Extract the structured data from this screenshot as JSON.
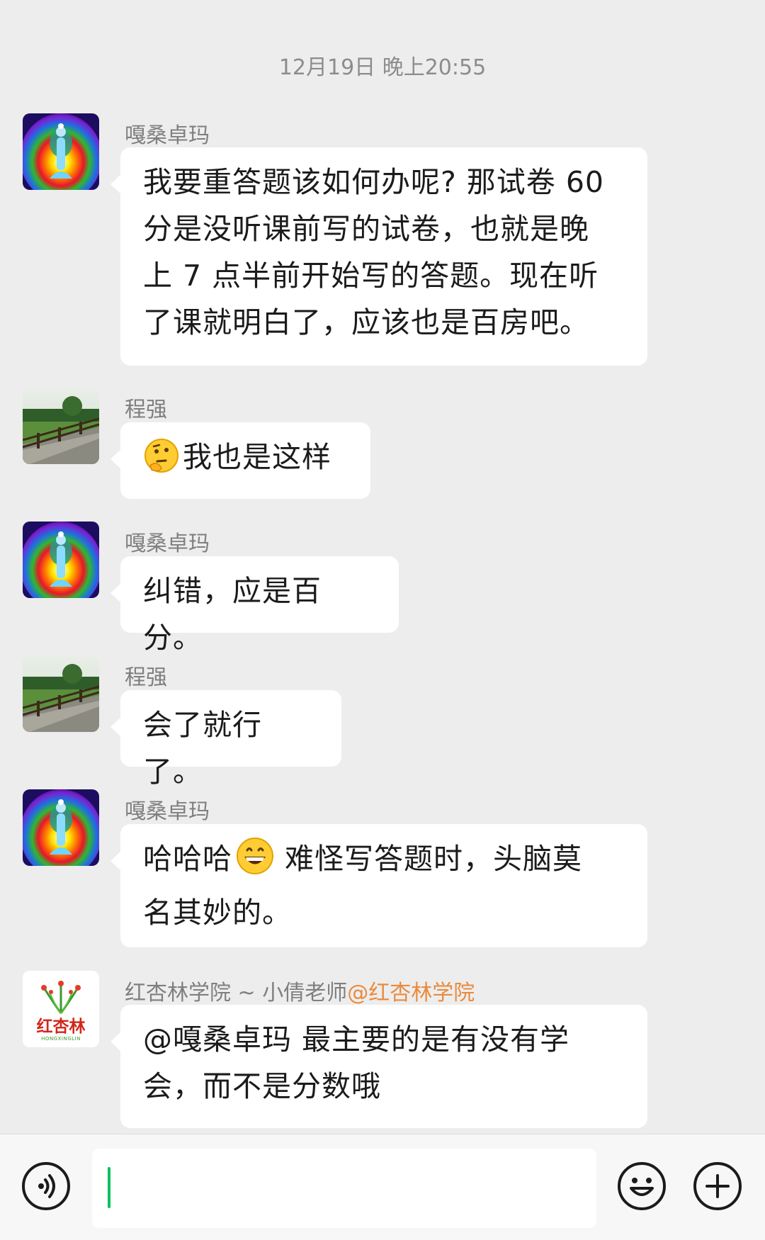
{
  "timestamp": "12月19日 晚上20:55",
  "messages": [
    {
      "sender": "嘎桑卓玛",
      "avatar": "chakra-meditation-avatar",
      "text": [
        "我要重答题该如何办呢? 那试卷 60",
        "分是没听课前写的试卷，也就是晚",
        "上 7 点半前开始写的答题。现在听",
        "了课就明白了，应该也是百房吧。"
      ]
    },
    {
      "sender": "程强",
      "avatar": "garden-path-avatar",
      "emoji": "thinking-face",
      "text": [
        "我也是这样"
      ]
    },
    {
      "sender": "嘎桑卓玛",
      "avatar": "chakra-meditation-avatar",
      "text": [
        "纠错，应是百分。"
      ]
    },
    {
      "sender": "程强",
      "avatar": "garden-path-avatar",
      "text": [
        "会了就行了。"
      ]
    },
    {
      "sender": "嘎桑卓玛",
      "avatar": "chakra-meditation-avatar",
      "emoji": "grinning-face",
      "text_parts": [
        "哈哈哈",
        " 难怪写答题时，头脑莫",
        "名其妙的。"
      ]
    },
    {
      "sender": "红杏林学院 ~ 小倩老师",
      "sender_tag": "@红杏林学院",
      "avatar": "hongxinglin-logo-avatar",
      "logo_text": "红杏林",
      "logo_sub": "HONGXINGLIN",
      "text": [
        "@嘎桑卓玛 最主要的是有没有学",
        "会，而不是分数哦"
      ]
    }
  ],
  "input": {
    "value": ""
  },
  "toolbar": {
    "voice_icon": "voice-icon",
    "emoji_icon": "emoji-icon",
    "plus_icon": "plus-icon"
  },
  "colors": {
    "background": "#ededed",
    "bubble": "#ffffff",
    "caret": "#07c160",
    "sender_tag": "#ea8a3d"
  }
}
